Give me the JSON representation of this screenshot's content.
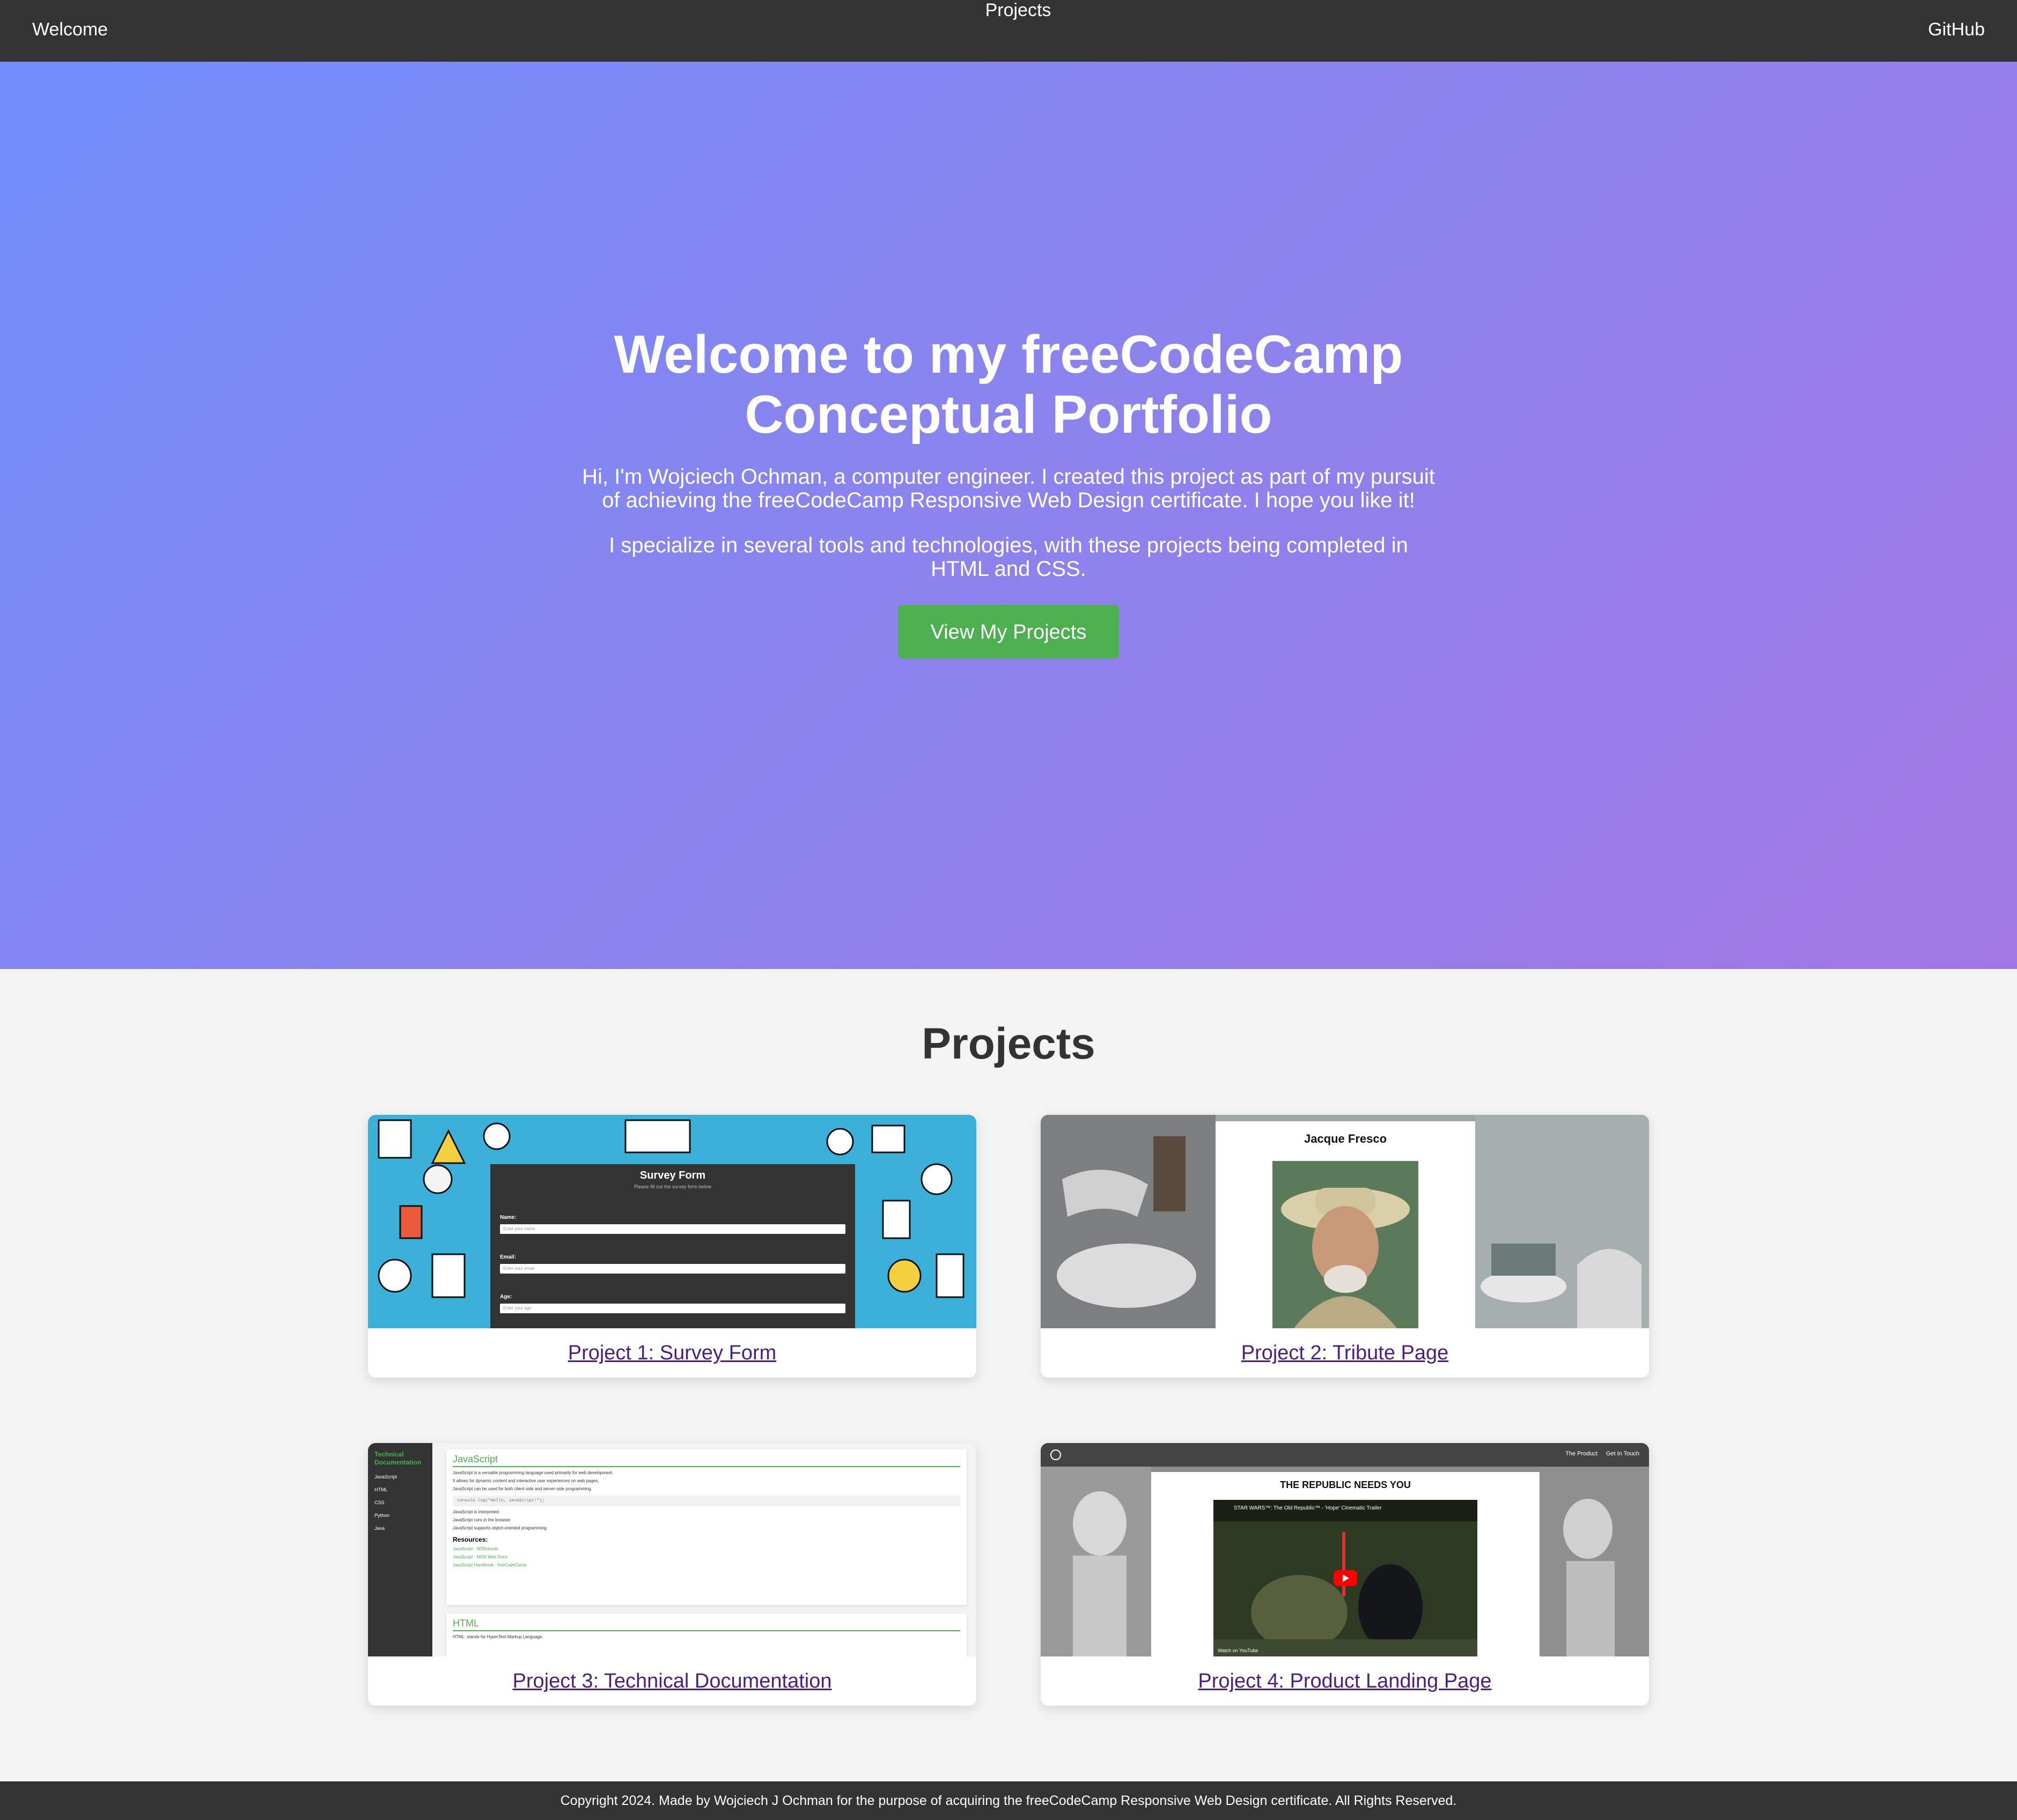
{
  "nav": {
    "welcome": "Welcome",
    "projects": "Projects",
    "github": "GitHub"
  },
  "hero": {
    "title": "Welcome to my freeCodeCamp Conceptual Portfolio",
    "intro": "Hi, I'm Wojciech Ochman, a computer engineer. I created this project as part of my pursuit of achieving the freeCodeCamp Responsive Web Design certificate. I hope you like it!",
    "specialize": "I specialize in several tools and technologies, with these projects being completed in HTML and CSS.",
    "cta": "View My Projects"
  },
  "projects": {
    "title": "Projects",
    "items": [
      {
        "label": "Project 1: Survey Form",
        "thumb": {
          "title": "Survey Form",
          "subtitle": "Please fill out the survey form below",
          "fields": [
            {
              "label": "Name:",
              "placeholder": "Enter your name"
            },
            {
              "label": "Email:",
              "placeholder": "Enter your email"
            },
            {
              "label": "Age:",
              "placeholder": "Enter your age"
            }
          ]
        }
      },
      {
        "label": "Project 2: Tribute Page",
        "thumb": {
          "name": "Jacque Fresco"
        }
      },
      {
        "label": "Project 3: Technical Documentation",
        "thumb": {
          "nav_title": "Technical Documentation",
          "nav_items": [
            "JavaScript",
            "HTML",
            "CSS",
            "Python",
            "Java"
          ],
          "section": "JavaScript",
          "lines": [
            "JavaScript is a versatile programming language used primarily for web development.",
            "It allows for dynamic content and interactive user experiences on web pages.",
            "JavaScript can be used for both client-side and server-side programming."
          ],
          "code": "console.log(\"Hello, JavaScript!\");",
          "bullets": [
            "JavaScript is interpreted",
            "JavaScript runs in the browser",
            "JavaScript supports object-oriented programming."
          ],
          "resources_title": "Resources:",
          "resources": [
            "JavaScript - W3Schools",
            "JavaScript - MDN Web Docs",
            "JavaScript Handbook - freeCodeCamp"
          ],
          "section2": "HTML",
          "section2_line": "HTML: stands for HyperText Markup Language."
        }
      },
      {
        "label": "Project 4: Product Landing Page",
        "thumb": {
          "nav_links": [
            "The Product",
            "Get In Touch"
          ],
          "headline": "THE REPUBLIC NEEDS YOU",
          "video_title": "STAR WARS™: The Old Republic™ - 'Hope' Cinematic Trailer",
          "watch_on": "Watch on YouTube"
        }
      }
    ]
  },
  "footer": {
    "text": "Copyright 2024. Made by Wojciech J Ochman for the purpose of acquiring the freeCodeCamp Responsive Web Design certificate. All Rights Reserved."
  },
  "colors": {
    "nav_bg": "#333333",
    "hero_start": "#6f8cfb",
    "hero_end": "#a277e3",
    "cta": "#4caf50",
    "link": "#4b1f7e",
    "page_bg": "#f3f3f3"
  }
}
